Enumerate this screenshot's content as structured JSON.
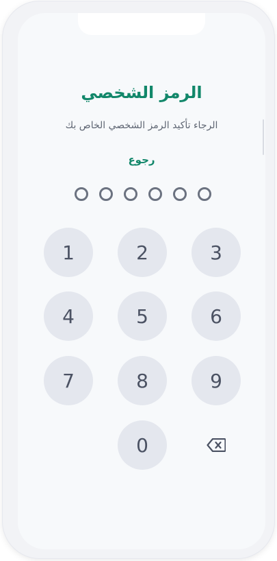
{
  "header": {
    "title": "الرمز الشخصي",
    "subtitle": "الرجاء تأكيد الرمز الشخصي الخاص بك",
    "back_label": "رجوع"
  },
  "pin": {
    "length": 6,
    "entered": 0
  },
  "keypad": {
    "keys": [
      "1",
      "2",
      "3",
      "4",
      "5",
      "6",
      "7",
      "8",
      "9",
      "0"
    ],
    "backspace_icon": "backspace-icon"
  },
  "colors": {
    "accent": "#12876a",
    "key_background": "#e4e7ee",
    "key_text": "#4b5263",
    "screen_background": "#f7f9fb"
  }
}
